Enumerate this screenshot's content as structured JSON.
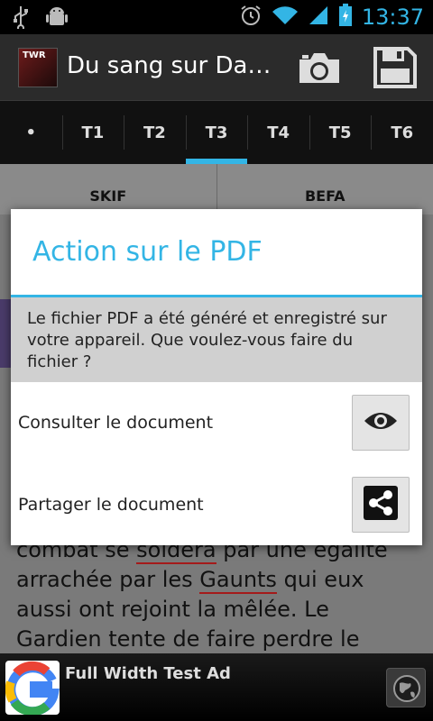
{
  "status_bar": {
    "time": "13:37"
  },
  "action_bar": {
    "title": "Du sang sur Da…",
    "logo_text": "TWR"
  },
  "tabs": [
    {
      "label": "•"
    },
    {
      "label": "T1"
    },
    {
      "label": "T2"
    },
    {
      "label": "T3",
      "active": true
    },
    {
      "label": "T4"
    },
    {
      "label": "T5"
    },
    {
      "label": "T6"
    }
  ],
  "subtabs": [
    {
      "label": "SKIF"
    },
    {
      "label": "BEFA"
    }
  ],
  "background_text": {
    "line1_a": "combat se ",
    "line1_u": "soldera",
    "line1_b": " par une égalité",
    "line2_a": "arrachée par les ",
    "line2_u": "Gaunts",
    "line2_b": " qui eux",
    "line3": "aussi ont rejoint la mêlée. Le",
    "line4": "Gardien tente de faire perdre le"
  },
  "dialog": {
    "title": "Action sur le PDF",
    "message": "Le fichier PDF a été généré et enregistré sur votre appareil. Que voulez-vous faire du fichier ?",
    "options": [
      {
        "label": "Consulter le document",
        "icon": "eye-icon"
      },
      {
        "label": "Partager le document",
        "icon": "share-icon"
      }
    ]
  },
  "ad": {
    "text": "Full Width Test Ad"
  },
  "colors": {
    "accent": "#33b5e5",
    "underline": "#a41a1a"
  }
}
